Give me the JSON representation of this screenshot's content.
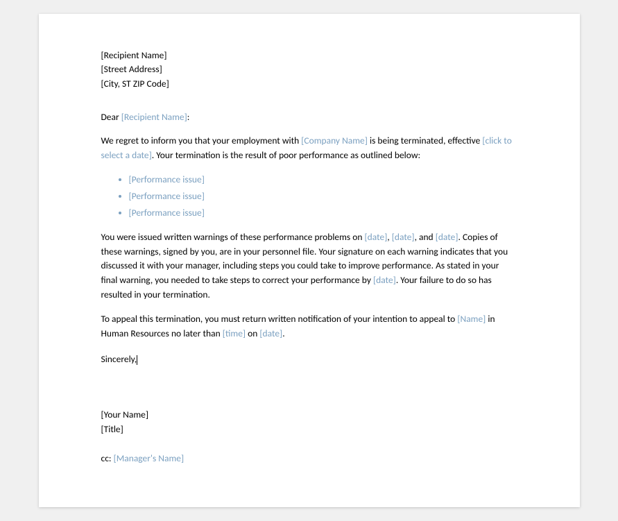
{
  "document": {
    "address": {
      "line1": "[Recipient Name]",
      "line2": "[Street Address]",
      "line3": "[City, ST ZIP Code]"
    },
    "salutation": {
      "text": "Dear ",
      "name_placeholder": "[Recipient Name]",
      "colon": ":"
    },
    "paragraph1": {
      "text_before": "We regret to inform you that your employment with ",
      "company_placeholder": "[Company Name]",
      "text_middle": " is being terminated, effective ",
      "date_placeholder": "[click to select a date]",
      "text_after": ". Your termination is the result of poor performance as outlined below:"
    },
    "bullet_items": [
      "[Performance issue]",
      "[Performance issue]",
      "[Performance issue]"
    ],
    "paragraph2": {
      "text_before": "You were issued written warnings of these performance problems on ",
      "date1": "[date]",
      "sep1": ", ",
      "date2": "[date]",
      "sep2": ", and ",
      "date3": "[date]",
      "text_after1": ". Copies of these warnings, signed by you, are in your personnel file. Your signature on each warning indicates  that you discussed it with your manager, including  steps you could take to improve performance. As stated in your final warning, you needed to take steps to correct your performance by ",
      "date4": "[date]",
      "text_after2": ". Your failure to do so has resulted in your termination."
    },
    "paragraph3": {
      "text_before": "To appeal this termination, you must return written notification of your intention to appeal to ",
      "name_placeholder": "[Name]",
      "text_middle": " in Human Resources no later than ",
      "time_placeholder": "[time]",
      "sep": " on ",
      "date_placeholder": "[date]",
      "text_after": "."
    },
    "sincerely": {
      "text": "Sincerely,"
    },
    "signature": {
      "name": "[Your Name]",
      "title": "[Title]"
    },
    "cc": {
      "text": "cc: ",
      "name_placeholder": "[Manager's Name]"
    }
  }
}
